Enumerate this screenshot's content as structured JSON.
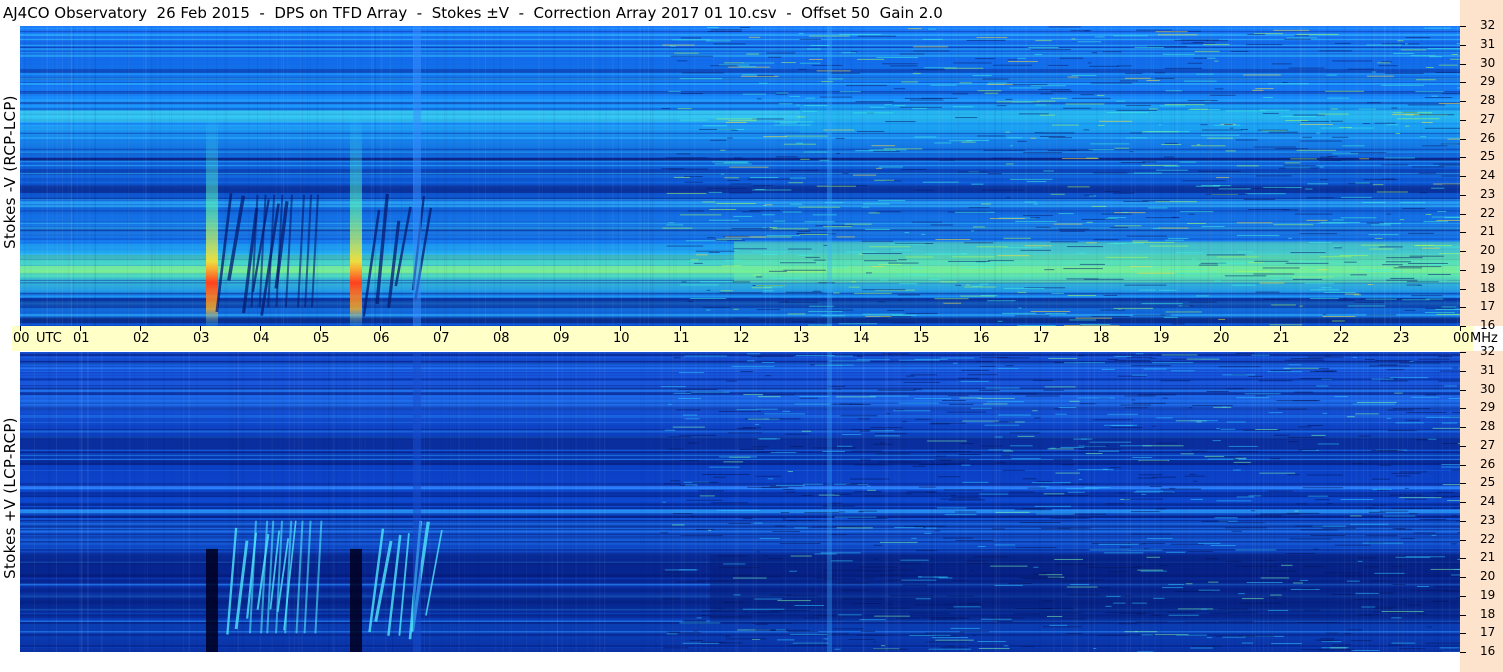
{
  "title": "AJ4CO Observatory  26 Feb 2015  -  DPS on TFD Array  -  Stokes ±V  -  Correction Array 2017 01 10.csv  -  Offset 50  Gain 2.0",
  "chart_data": [
    {
      "type": "heatmap",
      "panel": "top",
      "ylabel": "Stokes -V (RCP-LCP)",
      "y_unit": "MHz",
      "ylim": [
        16,
        32
      ],
      "y_ticks": [
        "16",
        "17",
        "18",
        "19",
        "20",
        "21",
        "22",
        "23",
        "24",
        "25",
        "26",
        "27",
        "28",
        "29",
        "30",
        "31",
        "32"
      ],
      "x_unit": "UTC",
      "xlim": [
        "00",
        "00"
      ],
      "x_ticks": [
        "00",
        "01",
        "02",
        "03",
        "04",
        "05",
        "06",
        "07",
        "08",
        "09",
        "10",
        "11",
        "12",
        "13",
        "14",
        "15",
        "16",
        "17",
        "18",
        "19",
        "20",
        "21",
        "22",
        "23",
        "00"
      ],
      "colormap": [
        "#00008f",
        "#0000ff",
        "#0080ff",
        "#00ffff",
        "#80ff80",
        "#ffff00",
        "#ff8000",
        "#ff0000"
      ],
      "grid": false,
      "bursts_utc": [
        3.2,
        5.6
      ]
    },
    {
      "type": "heatmap",
      "panel": "bottom",
      "ylabel": "Stokes +V (LCP-RCP)",
      "y_unit": "MHz",
      "ylim": [
        16,
        32
      ],
      "y_ticks": [
        "16",
        "17",
        "18",
        "19",
        "20",
        "21",
        "22",
        "23",
        "24",
        "25",
        "26",
        "27",
        "28",
        "29",
        "30",
        "31",
        "32"
      ],
      "x_unit": "UTC",
      "xlim": [
        "00",
        "00"
      ],
      "x_ticks": [
        "00",
        "01",
        "02",
        "03",
        "04",
        "05",
        "06",
        "07",
        "08",
        "09",
        "10",
        "11",
        "12",
        "13",
        "14",
        "15",
        "16",
        "17",
        "18",
        "19",
        "20",
        "21",
        "22",
        "23",
        "00"
      ],
      "colormap": [
        "#00008f",
        "#0000ff",
        "#0080ff",
        "#00ffff",
        "#80ff80",
        "#ffff00",
        "#ff8000",
        "#ff0000"
      ],
      "grid": false,
      "bursts_utc": [
        3.2,
        5.6
      ]
    }
  ],
  "x_axis": {
    "first_label": "00",
    "utc_label": "UTC",
    "last_label": "00",
    "unit_label": "MHz"
  }
}
